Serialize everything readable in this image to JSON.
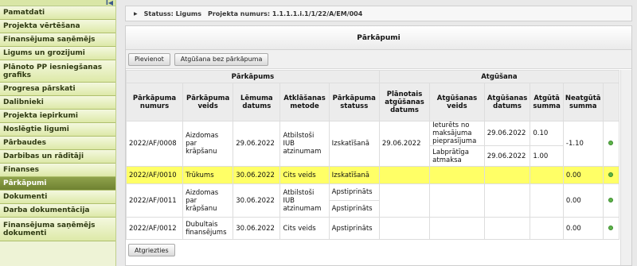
{
  "sidebar": {
    "collapse_glyph": "I◀",
    "items": [
      {
        "label": "Pamatdati",
        "active": false,
        "h": 17
      },
      {
        "label": "Projekta vērtēšana",
        "active": false,
        "h": 17
      },
      {
        "label": "Finansējuma saņēmējs",
        "active": false,
        "h": 17
      },
      {
        "label": "Ligums un grozijumi",
        "active": false,
        "h": 17
      },
      {
        "label": "Plānoto PP iesniegšanas grafiks",
        "active": false,
        "h": 28
      },
      {
        "label": "Progresa pārskati",
        "active": false,
        "h": 17
      },
      {
        "label": "Dalibnieki",
        "active": false,
        "h": 17
      },
      {
        "label": "Projekta iepirkumi",
        "active": false,
        "h": 17
      },
      {
        "label": "Noslēgtie ligumi",
        "active": false,
        "h": 17
      },
      {
        "label": "Pārbaudes",
        "active": false,
        "h": 17
      },
      {
        "label": "Darbibas un rādītāji",
        "active": false,
        "h": 17
      },
      {
        "label": "Finanses",
        "active": false,
        "h": 17
      },
      {
        "label": "Pārkāpumi",
        "active": true,
        "h": 17
      },
      {
        "label": "Dokumenti",
        "active": false,
        "h": 17
      },
      {
        "label": "Darba dokumentācija",
        "active": false,
        "h": 17
      },
      {
        "label": "Finansējuma saņēmējs dokumenti",
        "active": false,
        "h": 30
      }
    ]
  },
  "breadcrumb": {
    "status": "Statuss: Ligums",
    "project": "Projekta numurs: 1.1.1.1.i.1/1/22/A/EM/004"
  },
  "panel": {
    "title": "Pārkāpumi",
    "buttons": {
      "add": "Pievienot",
      "recovery_without": "Atgūšana bez pārkāpuma",
      "back": "Atgriezties"
    }
  },
  "table": {
    "groups": {
      "violations": "Pārkāpums",
      "recovery": "Atgūšana"
    },
    "headers": {
      "number": "Pārkāpuma numurs",
      "type": "Pārkāpuma veids",
      "decision_date": "Lēmuma datums",
      "method": "Atklāšanas metode",
      "status": "Pārkāpuma statuss",
      "planned_date": "Plānotais atgūšanas datums",
      "rec_type": "Atgūšanas veids",
      "rec_date": "Atgūšanas datums",
      "rec_sum": "Atgūtā summa",
      "unrec_sum": "Neatgūtā summa"
    },
    "rows": [
      {
        "number": "2022/AF/0008",
        "type": "Aizdomas par krāpšanu",
        "decision_date": "29.06.2022",
        "method": "Atbilstoši IUB atzinumam",
        "status": "Izskatīšanā",
        "planned_date": "29.06.2022",
        "unrec_sum": "-1.10",
        "highlight": false,
        "sub": [
          {
            "rec_type": "Ieturēts no maksājuma pieprasījuma",
            "rec_date": "29.06.2022",
            "rec_sum": "0.10"
          },
          {
            "rec_type": "Labprātīga atmaksa",
            "rec_date": "29.06.2022",
            "rec_sum": "1.00"
          }
        ]
      },
      {
        "number": "2022/AF/0010",
        "type": "Trūkums",
        "decision_date": "30.06.2022",
        "method": "Cits veids",
        "status": "Izskatīšanā",
        "planned_date": "",
        "unrec_sum": "0.00",
        "highlight": true,
        "sub": [
          {
            "rec_type": "",
            "rec_date": "",
            "rec_sum": ""
          }
        ]
      },
      {
        "number": "2022/AF/0011",
        "type": "Aizdomas par krāpšanu",
        "decision_date": "30.06.2022",
        "method": "Atbilstoši IUB atzinumam",
        "status": "Apstiprināts",
        "planned_date": "",
        "unrec_sum": "0.00",
        "highlight": false,
        "sub": [
          {
            "rec_type": "",
            "rec_date": "",
            "rec_sum": ""
          }
        ],
        "status_extra": "Apstiprināts"
      },
      {
        "number": "2022/AF/0012",
        "type": "Dubultais finansējums",
        "decision_date": "30.06.2022",
        "method": "Cits veids",
        "status": "Apstiprināts",
        "planned_date": "",
        "unrec_sum": "0.00",
        "highlight": false,
        "sub": [
          {
            "rec_type": "",
            "rec_date": "",
            "rec_sum": ""
          }
        ]
      }
    ]
  },
  "colors": {
    "highlight": "#ffff66",
    "active_nav": "#7d8f3a",
    "status_dot": "#5db34a"
  },
  "icons": {
    "status": "green-dot-icon",
    "expand": "triangle-right-icon",
    "collapse": "collapse-left-icon"
  }
}
